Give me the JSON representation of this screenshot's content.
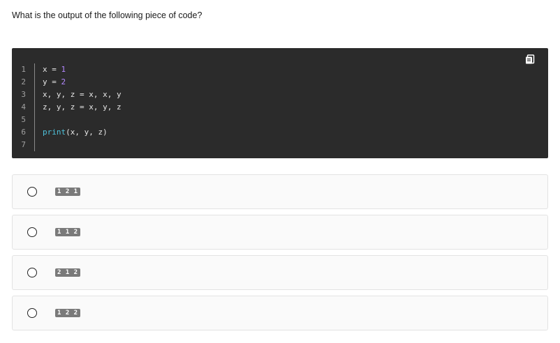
{
  "question": "What is the output of the following piece of code?",
  "code": {
    "line_numbers": [
      "1",
      "2",
      "3",
      "4",
      "5",
      "6",
      "7"
    ],
    "lines": [
      {
        "tokens": [
          {
            "text": "x = ",
            "kind": "plain"
          },
          {
            "text": "1",
            "kind": "num"
          }
        ]
      },
      {
        "tokens": [
          {
            "text": "y = ",
            "kind": "plain"
          },
          {
            "text": "2",
            "kind": "num"
          }
        ]
      },
      {
        "tokens": [
          {
            "text": "x, y, z = x, x, y",
            "kind": "plain"
          }
        ]
      },
      {
        "tokens": [
          {
            "text": "z, y, z = x, y, z",
            "kind": "plain"
          }
        ]
      },
      {
        "tokens": []
      },
      {
        "tokens": [
          {
            "text": "print",
            "kind": "fn"
          },
          {
            "text": "(x, y, z)",
            "kind": "plain"
          }
        ]
      },
      {
        "tokens": []
      }
    ],
    "colors": {
      "background": "#2b2b2b",
      "number": "#b388ff",
      "builtin": "#4fc3dc"
    },
    "copy_icon": "clipboard-copy-icon"
  },
  "options": [
    {
      "label": "1 2 1"
    },
    {
      "label": "1 1 2"
    },
    {
      "label": "2 1 2"
    },
    {
      "label": "1 2 2"
    }
  ]
}
